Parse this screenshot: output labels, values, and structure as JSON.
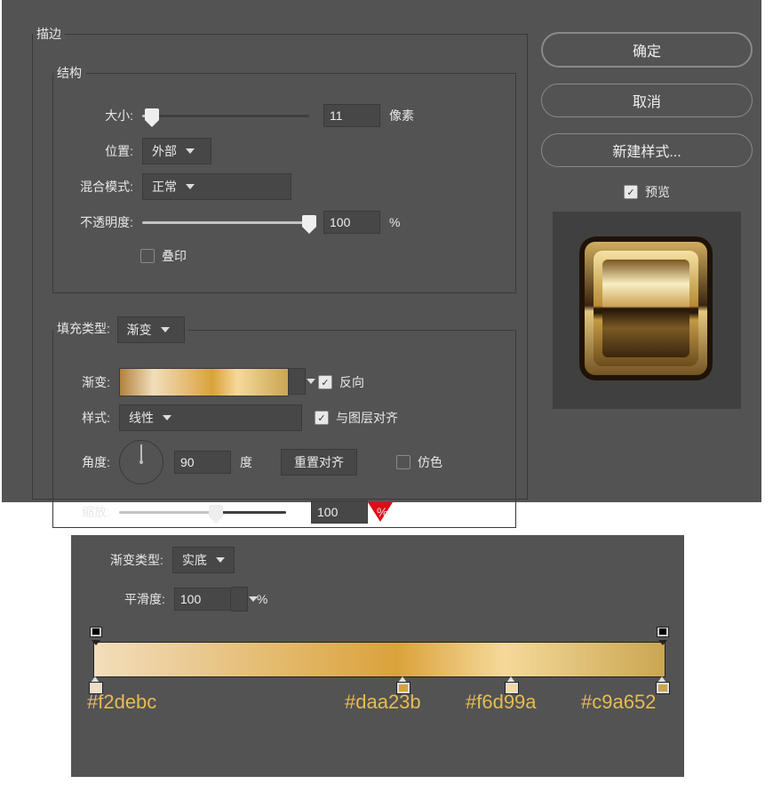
{
  "stroke": {
    "title": "描边",
    "structure": {
      "title": "结构",
      "size_label": "大小:",
      "size_value": "11",
      "size_unit": "像素",
      "position_label": "位置:",
      "position_value": "外部",
      "blend_label": "混合模式:",
      "blend_value": "正常",
      "opacity_label": "不透明度:",
      "opacity_value": "100",
      "opacity_unit": "%",
      "overprint_label": "叠印"
    },
    "fill": {
      "title_label": "填充类型:",
      "title_value": "渐变",
      "gradient_label": "渐变:",
      "reverse_label": "反向",
      "style_label": "样式:",
      "style_value": "线性",
      "align_label": "与图层对齐",
      "angle_label": "角度:",
      "angle_value": "90",
      "angle_unit": "度",
      "reset_label": "重置对齐",
      "dither_label": "仿色",
      "scale_label": "缩放:",
      "scale_value": "100",
      "scale_unit": "%"
    }
  },
  "buttons": {
    "ok": "确定",
    "cancel": "取消",
    "new_style": "新建样式...",
    "preview": "预览"
  },
  "editor": {
    "type_label": "渐变类型:",
    "type_value": "实底",
    "smoothness_label": "平滑度:",
    "smoothness_value": "100",
    "smoothness_unit": "%",
    "stops": {
      "c1": "#f2debc",
      "c2": "#daa23b",
      "c3": "#f6d99a",
      "c4": "#c9a652"
    }
  }
}
